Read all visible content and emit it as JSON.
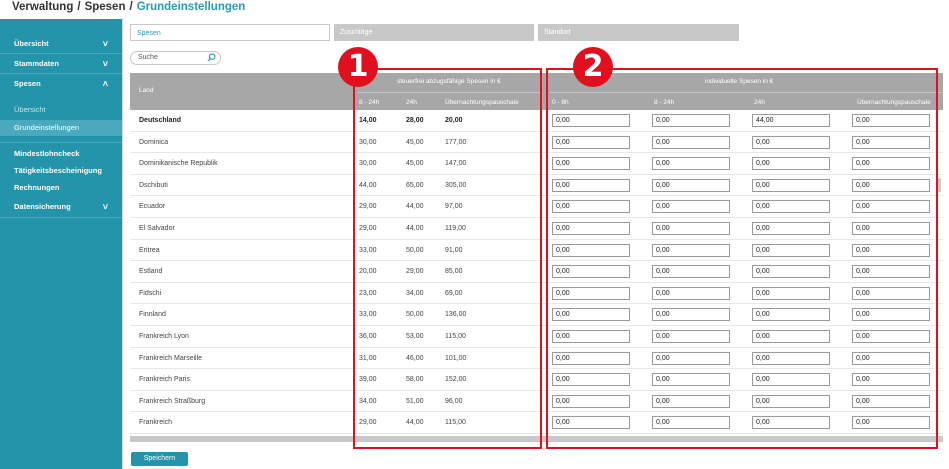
{
  "breadcrumb": {
    "part1": "Verwaltung",
    "sep": "/",
    "part2": "Spesen",
    "current": "Grundeinstellungen"
  },
  "sidebar": {
    "items": [
      {
        "label": "Übersicht",
        "chevron": "˅"
      },
      {
        "label": "Stammdaten",
        "chevron": "˅"
      },
      {
        "label": "Spesen",
        "chevron": "˄"
      }
    ],
    "sub_items": [
      {
        "label": "Übersicht"
      },
      {
        "label": "Grundeinstellungen"
      }
    ],
    "items2": [
      {
        "label": "Mindestlohncheck"
      },
      {
        "label": "Tätigkeitsbescheinigung"
      },
      {
        "label": "Rechnungen"
      },
      {
        "label": "Datensicherung",
        "chevron": "˅"
      }
    ]
  },
  "tabs": [
    {
      "label": "Spesen"
    },
    {
      "label": "Zuschläge"
    },
    {
      "label": "Standort"
    }
  ],
  "search": {
    "placeholder": "Suche"
  },
  "table": {
    "header_land": "Land",
    "group1": "steuerfrei abzugsfähige Spesen in €",
    "group2": "individuelle Spesen in €",
    "cols_tax": [
      "8 - 24h",
      "24h",
      "Übernachtungspauschale"
    ],
    "cols_ind": [
      "0 - 8h",
      "8 - 24h",
      "24h",
      "Übernachtungspauschale"
    ],
    "rows": [
      {
        "land": "Deutschland",
        "tax": [
          "14,00",
          "28,00",
          "20,00"
        ],
        "ind": [
          "0,00",
          "0,00",
          "44,00",
          "0,00"
        ]
      },
      {
        "land": "Dominica",
        "tax": [
          "30,00",
          "45,00",
          "177,00"
        ],
        "ind": [
          "0,00",
          "0,00",
          "0,00",
          "0,00"
        ]
      },
      {
        "land": "Dominikanische Republik",
        "tax": [
          "30,00",
          "45,00",
          "147,00"
        ],
        "ind": [
          "0,00",
          "0,00",
          "0,00",
          "0,00"
        ]
      },
      {
        "land": "Dschibuti",
        "tax": [
          "44,00",
          "65,00",
          "305,00"
        ],
        "ind": [
          "0,00",
          "0,00",
          "0,00",
          "0,00"
        ]
      },
      {
        "land": "Ecuador",
        "tax": [
          "29,00",
          "44,00",
          "97,00"
        ],
        "ind": [
          "0,00",
          "0,00",
          "0,00",
          "0,00"
        ]
      },
      {
        "land": "El Salvador",
        "tax": [
          "29,00",
          "44,00",
          "119,00"
        ],
        "ind": [
          "0,00",
          "0,00",
          "0,00",
          "0,00"
        ]
      },
      {
        "land": "Eritrea",
        "tax": [
          "33,00",
          "50,00",
          "91,00"
        ],
        "ind": [
          "0,00",
          "0,00",
          "0,00",
          "0,00"
        ]
      },
      {
        "land": "Estland",
        "tax": [
          "20,00",
          "29,00",
          "85,00"
        ],
        "ind": [
          "0,00",
          "0,00",
          "0,00",
          "0,00"
        ]
      },
      {
        "land": "Fidschi",
        "tax": [
          "23,00",
          "34,00",
          "69,00"
        ],
        "ind": [
          "0,00",
          "0,00",
          "0,00",
          "0,00"
        ]
      },
      {
        "land": "Finnland",
        "tax": [
          "33,00",
          "50,00",
          "136,00"
        ],
        "ind": [
          "0,00",
          "0,00",
          "0,00",
          "0,00"
        ]
      },
      {
        "land": "Frankreich Lyon",
        "tax": [
          "36,00",
          "53,00",
          "115,00"
        ],
        "ind": [
          "0,00",
          "0,00",
          "0,00",
          "0,00"
        ]
      },
      {
        "land": "Frankreich Marseille",
        "tax": [
          "31,00",
          "46,00",
          "101,00"
        ],
        "ind": [
          "0,00",
          "0,00",
          "0,00",
          "0,00"
        ]
      },
      {
        "land": "Frankreich Paris",
        "tax": [
          "39,00",
          "58,00",
          "152,00"
        ],
        "ind": [
          "0,00",
          "0,00",
          "0,00",
          "0,00"
        ]
      },
      {
        "land": "Frankreich Straßburg",
        "tax": [
          "34,00",
          "51,00",
          "96,00"
        ],
        "ind": [
          "0,00",
          "0,00",
          "0,00",
          "0,00"
        ]
      },
      {
        "land": "Frankreich",
        "tax": [
          "29,00",
          "44,00",
          "115,00"
        ],
        "ind": [
          "0,00",
          "0,00",
          "0,00",
          "0,00"
        ]
      }
    ]
  },
  "save_label": "Speichern",
  "markers": [
    "1",
    "2"
  ],
  "colors": {
    "accent": "#2394aa",
    "header_gray": "#a7a7a7",
    "annotation_red": "#e0101f"
  }
}
